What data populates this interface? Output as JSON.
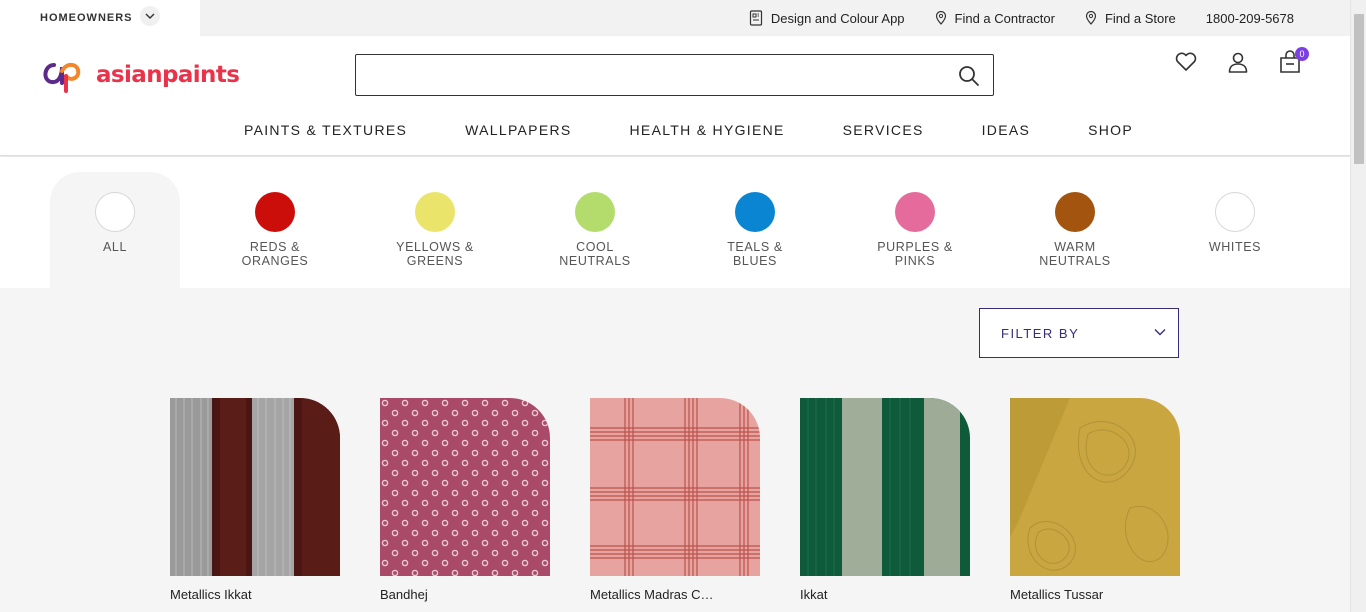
{
  "topbar": {
    "segment": "HOMEOWNERS",
    "links": [
      {
        "label": "Design and Colour App",
        "icon": "phone-app-icon"
      },
      {
        "label": "Find a Contractor",
        "icon": "location-pin-icon"
      },
      {
        "label": "Find a Store",
        "icon": "location-pin-icon"
      },
      {
        "label": "1800-209-5678",
        "icon": ""
      }
    ]
  },
  "header": {
    "logo_text": "asianpaints",
    "search": {
      "placeholder": "",
      "value": ""
    },
    "cart_count": "0",
    "icons": [
      "wishlist-heart-icon",
      "account-user-icon",
      "cart-bag-icon"
    ]
  },
  "nav": {
    "items": [
      "PAINTS & TEXTURES",
      "WALLPAPERS",
      "HEALTH & HYGIENE",
      "SERVICES",
      "IDEAS",
      "SHOP"
    ]
  },
  "families": [
    {
      "label": "ALL",
      "color": "#ffffff",
      "active": true
    },
    {
      "label": "REDS &\nORANGES",
      "color": "#cc0e0a"
    },
    {
      "label": "YELLOWS &\nGREENS",
      "color": "#eae56a"
    },
    {
      "label": "COOL\nNEUTRALS",
      "color": "#b3dc6c"
    },
    {
      "label": "TEALS &\nBLUES",
      "color": "#0985d1"
    },
    {
      "label": "PURPLES &\nPINKS",
      "color": "#e46b9c"
    },
    {
      "label": "WARM\nNEUTRALS",
      "color": "#a3540e"
    },
    {
      "label": "WHITES",
      "color": "#ffffff"
    }
  ],
  "filter": {
    "label": "FILTER BY"
  },
  "products": [
    {
      "title": "Metallics Ikkat"
    },
    {
      "title": "Bandhej"
    },
    {
      "title": "Metallics Madras Check"
    },
    {
      "title": "Ikkat"
    },
    {
      "title": "Metallics Tussar"
    }
  ],
  "colors": {
    "accent": "#3a2a7a",
    "brand": "#e9334a",
    "badge": "#7b3fe4"
  }
}
